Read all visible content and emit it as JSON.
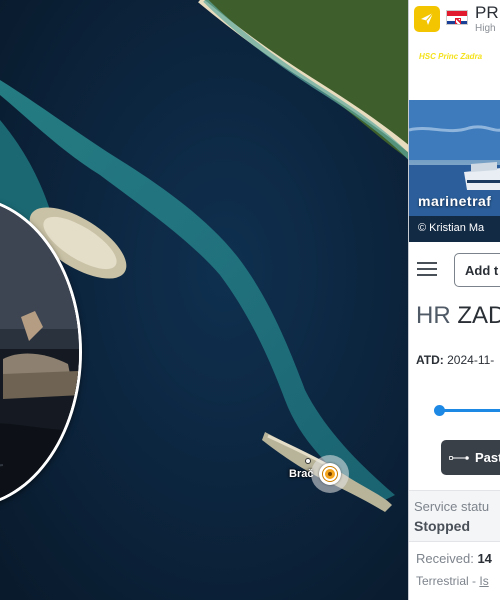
{
  "map": {
    "place_label": "Brač"
  },
  "video_inset": {
    "label": "video-preview"
  },
  "panel": {
    "header": {
      "vessel_name_short": "PR",
      "vessel_type_short": "High",
      "type_icon": "send-icon",
      "flag": "HR"
    },
    "photo": {
      "caption_top": "HSC Princ Zadra",
      "watermark": "marinetraf",
      "credit": "© Kristian Ma"
    },
    "toolbar": {
      "menu_icon": "hamburger-icon",
      "add_label": "Add t"
    },
    "vessel_title": {
      "prefix": "HR",
      "name": "ZAD"
    },
    "atd": {
      "label": "ATD:",
      "value": "2024-11-"
    },
    "past_track_label": "Past",
    "service_status": {
      "label": "Service statu",
      "value": "Stopped"
    },
    "received": {
      "label": "Received:",
      "value": "14"
    },
    "terrestrial": {
      "label": "Terrestrial -",
      "link": "Is"
    }
  },
  "colors": {
    "accent_blue": "#1e88e5",
    "badge_yellow": "#f2c500",
    "marker_orange": "#f4a51c"
  }
}
